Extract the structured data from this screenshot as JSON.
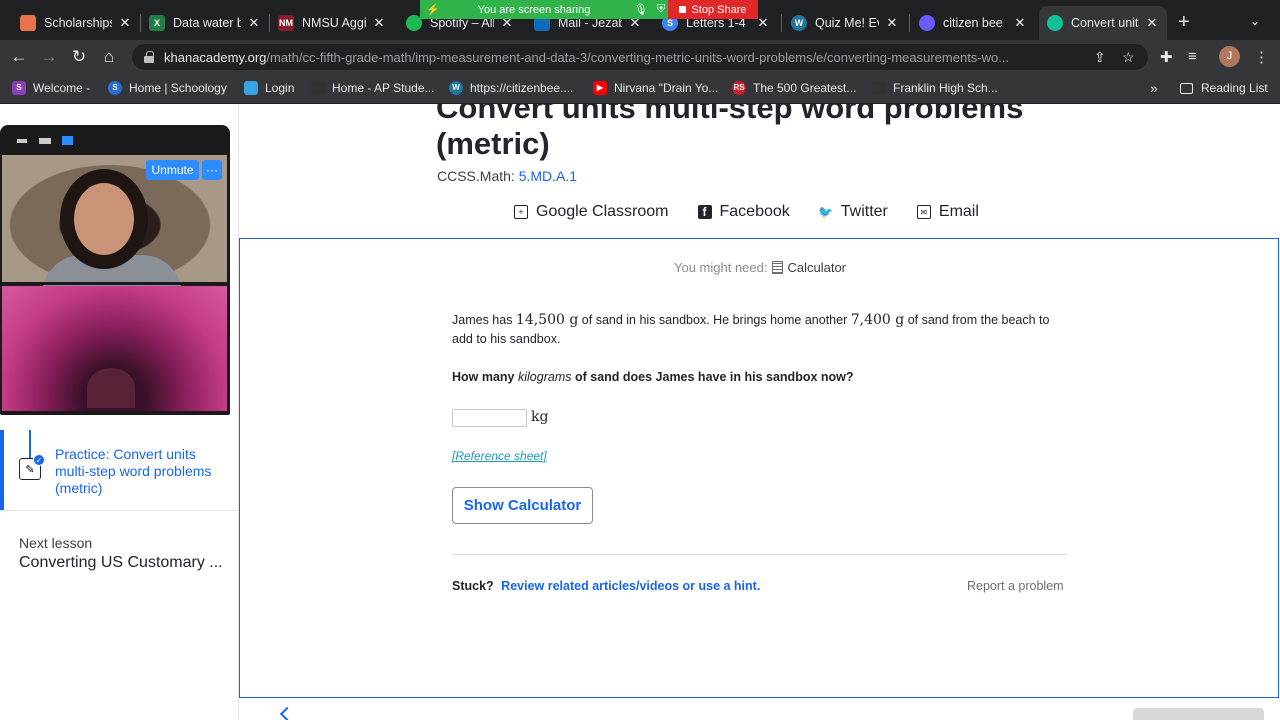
{
  "browser": {
    "tabs": [
      {
        "title": "Scholarships",
        "fav": "",
        "color": "#e8734a"
      },
      {
        "title": "Data water b",
        "fav": "X",
        "color": "#1e7e45"
      },
      {
        "title": "NMSU Aggie",
        "fav": "NM",
        "color": "#8b1a2b"
      },
      {
        "title": "Spotify – All",
        "fav": "",
        "color": "#1db954"
      },
      {
        "title": "Mail - Jezab",
        "fav": "",
        "color": "#0f6cbd"
      },
      {
        "title": "Letters 1-4",
        "fav": "S",
        "color": "#3b82f6"
      },
      {
        "title": "Quiz Me! Eve",
        "fav": "W",
        "color": "#21759b"
      },
      {
        "title": "citizen bee F",
        "fav": "",
        "color": "#6b5bff"
      },
      {
        "title": "Convert units",
        "fav": "",
        "color": "#14bf96"
      }
    ],
    "new_tab_label": "+",
    "url_host": "khanacademy.org",
    "url_path": "/math/cc-fifth-grade-math/imp-measurement-and-data-3/converting-metric-units-word-problems/e/converting-measurements-wo...",
    "avatar_initial": "J",
    "bookmarks": [
      {
        "label": "Welcome -",
        "color": "#8b3fb5",
        "fav": "S"
      },
      {
        "label": "Home | Schoology",
        "color": "#2a6bd1",
        "fav": "S"
      },
      {
        "label": "Login",
        "color": "#3aa3e3",
        "fav": ""
      },
      {
        "label": "Home - AP Stude...",
        "color": "#333",
        "fav": ""
      },
      {
        "label": "https://citizenbee....",
        "color": "#21759b",
        "fav": "W"
      },
      {
        "label": "Nirvana \"Drain Yo...",
        "color": "#ff0000",
        "fav": "▶"
      },
      {
        "label": "The 500 Greatest...",
        "color": "#d11a2a",
        "fav": "RS"
      },
      {
        "label": "Franklin High Sch...",
        "color": "#333",
        "fav": ""
      }
    ],
    "reading_list": "Reading List"
  },
  "screen_share": {
    "status": "You are screen sharing",
    "stop_label": "Stop Share"
  },
  "zoom": {
    "unmute_label": "Unmute",
    "more_label": "···"
  },
  "lesson": {
    "title": "Convert units multi-step word problems (metric)",
    "ccss_prefix": "CCSS.Math:",
    "ccss_code": "5.MD.A.1",
    "share": {
      "google_classroom": "Google Classroom",
      "facebook": "Facebook",
      "twitter": "Twitter",
      "email": "Email"
    }
  },
  "exercise": {
    "might_need": "You might need:",
    "calculator": "Calculator",
    "problem_a": "James has ",
    "amount1": "14,500 g",
    "problem_b": " of sand in his sandbox. He brings home another ",
    "amount2": "7,400 g",
    "problem_c": " of sand from the beach to add to his sandbox.",
    "question_a": "How many ",
    "question_em": "kilograms",
    "question_b": " of sand does James have in his sandbox now?",
    "answer_value": "",
    "unit": "kg",
    "reference_sheet": "[Reference sheet]",
    "show_calculator": "Show Calculator",
    "stuck": "Stuck?",
    "stuck_link": "Review related articles/videos or use a hint.",
    "report": "Report a problem"
  },
  "sidebar": {
    "practice_label": "Practice: Convert units multi-step word problems (metric)",
    "next_lesson_label": "Next lesson",
    "next_lesson_title": "Converting US Customary ..."
  }
}
